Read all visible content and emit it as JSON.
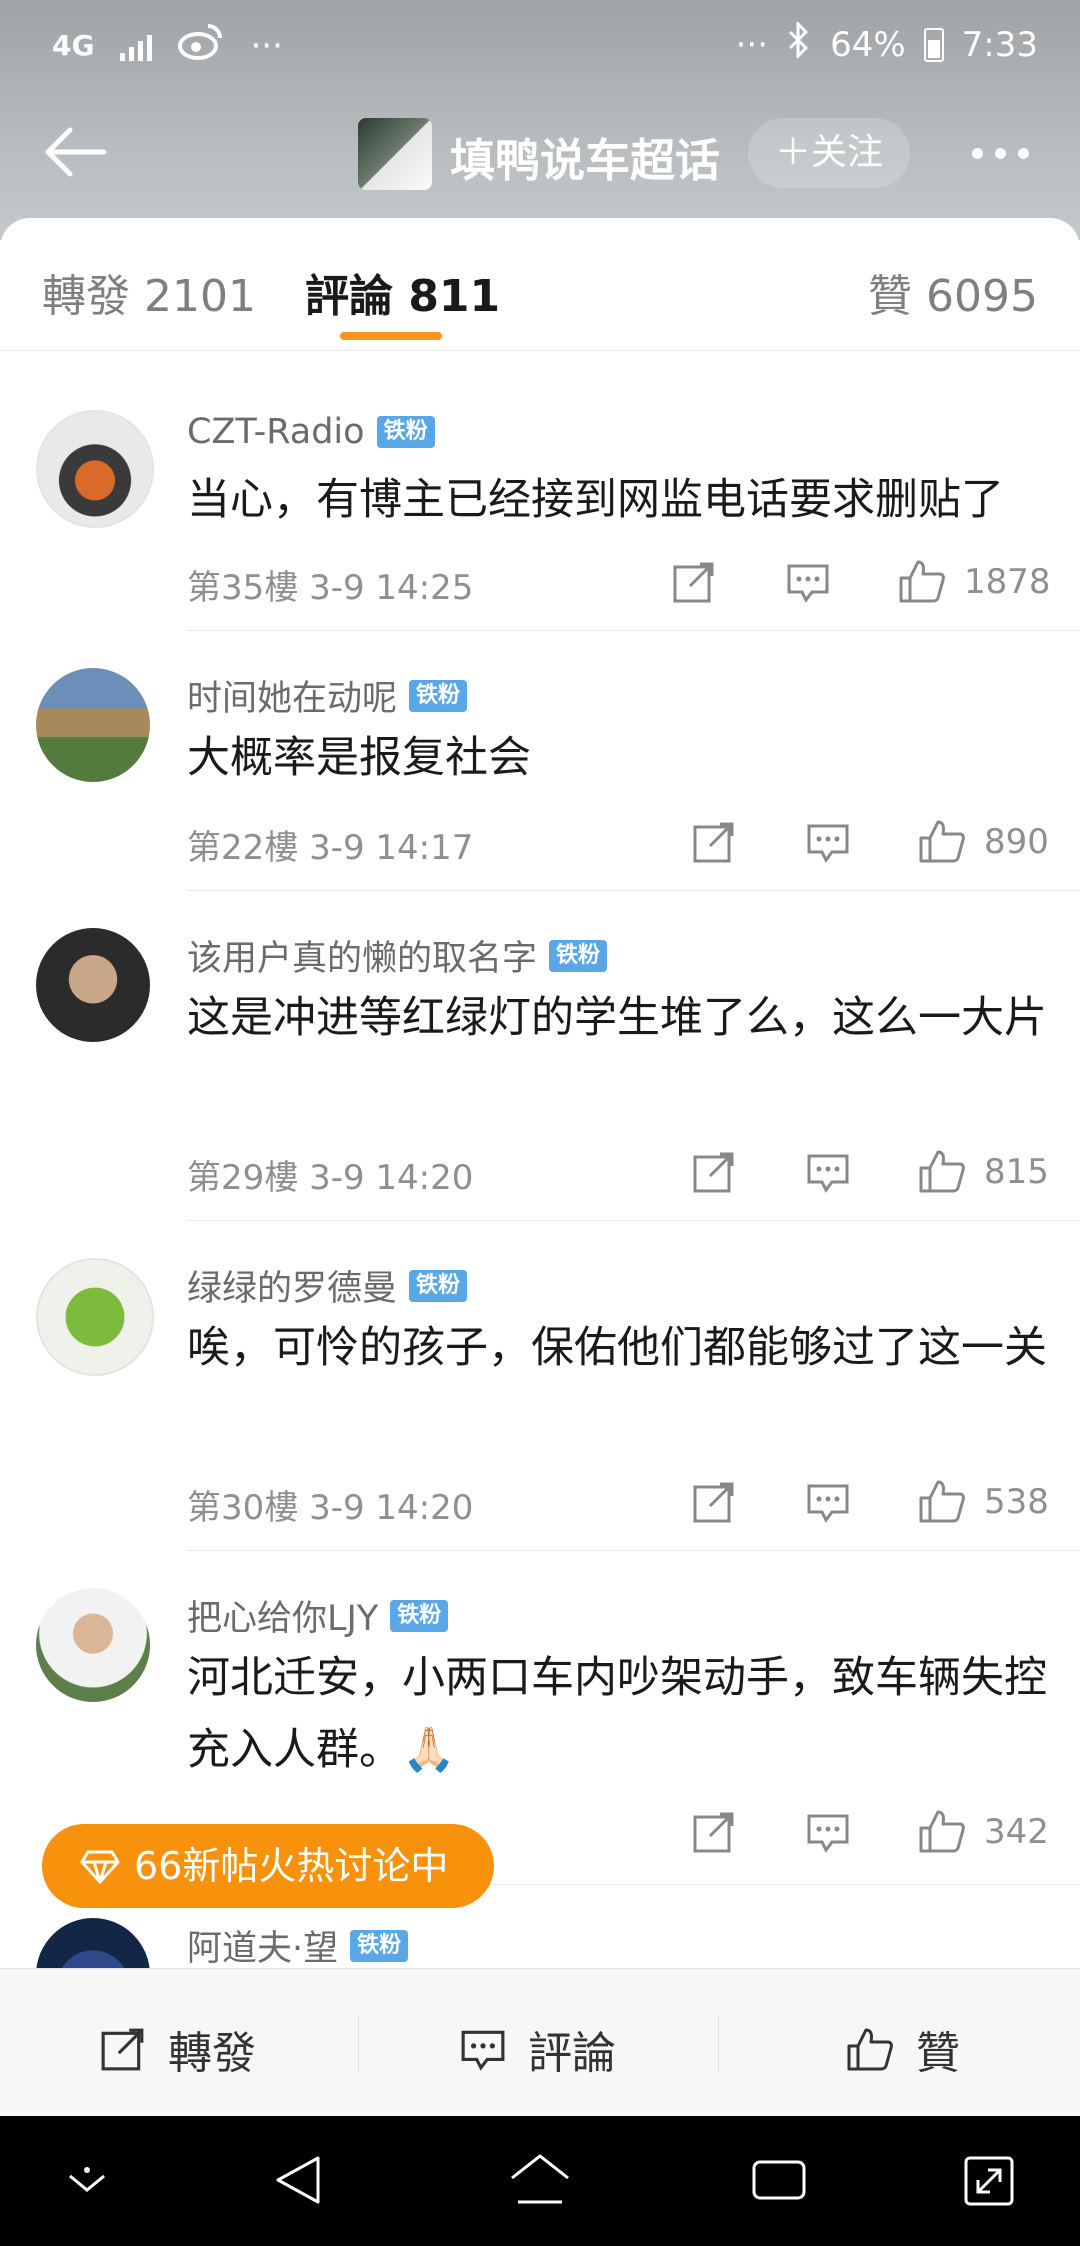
{
  "status": {
    "network": "4G",
    "battery": "64%",
    "time": "7:33",
    "dots": "···"
  },
  "header": {
    "title": "填鸭说车超话",
    "follow": "＋关注"
  },
  "tabs": {
    "repost": "轉發 2101",
    "comment": "評論 811",
    "like": "贊 6095"
  },
  "comments": [
    {
      "name": "CZT-Radio",
      "badge": "铁粉",
      "text": "当心，有博主已经接到网监电话要求删贴了",
      "meta": "第35樓 3-9 14:25",
      "likes": "1878"
    },
    {
      "name": "时间她在动呢",
      "badge": "铁粉",
      "text": "大概率是报复社会",
      "meta": "第22樓 3-9 14:17",
      "likes": "890"
    },
    {
      "name": "该用户真的懒的取名字",
      "badge": "铁粉",
      "text": "这是冲进等红绿灯的学生堆了么，这么一大片",
      "meta": "第29樓 3-9 14:20",
      "likes": "815"
    },
    {
      "name": "绿绿的罗德曼",
      "badge": "铁粉",
      "text": "唉，可怜的孩子，保佑他们都能够过了这一关",
      "meta": "第30樓 3-9 14:20",
      "likes": "538"
    },
    {
      "name": "把心给你LJY",
      "badge": "铁粉",
      "text": "河北迁安，小两口车内吵架动手，致车辆失控充入人群。🙏🏻",
      "meta": "",
      "likes": "342"
    },
    {
      "name": "阿道夫·望",
      "badge": "铁粉"
    }
  ],
  "hot_banner": "66新帖火热讨论中",
  "bottom": {
    "repost": "轉發",
    "comment": "評論",
    "like": "贊"
  }
}
